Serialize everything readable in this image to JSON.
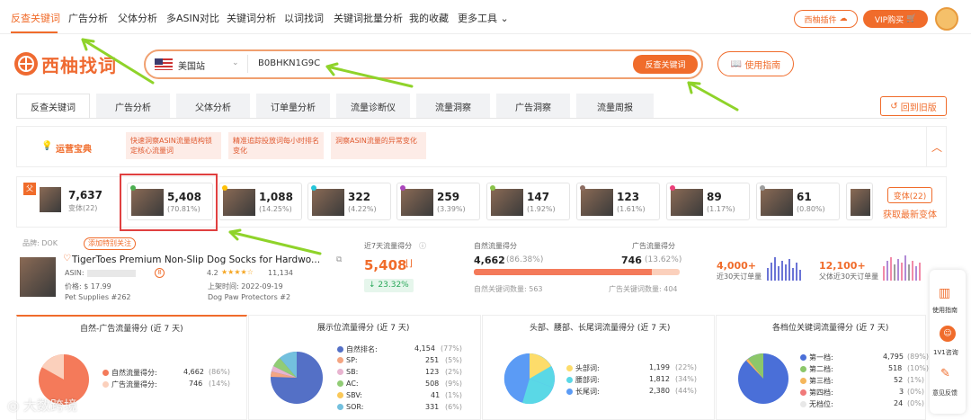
{
  "topnav": {
    "items": [
      "反查关键词",
      "广告分析",
      "父体分析",
      "多ASIN对比",
      "关键词分析",
      "以词找词",
      "关键词批量分析",
      "我的收藏",
      "更多工具"
    ],
    "plugin_button": "西柚插件",
    "vip_button": "VIP购买"
  },
  "brand": {
    "name": "西柚找词"
  },
  "search": {
    "marketplace": "美国站",
    "query": "B0BHKN1G9C",
    "submit_label": "反查关键词",
    "guide_label": "使用指南"
  },
  "tabs": [
    "反查关键词",
    "广告分析",
    "父体分析",
    "订单量分析",
    "流量诊断仪",
    "流量洞察",
    "广告洞察",
    "流量周报"
  ],
  "back_old_label": "回到旧版",
  "ops": {
    "label": "运营宝典",
    "tips": [
      "快速洞察ASIN流量结构锁定核心流量词",
      "精准追踪投放词每小时排名变化",
      "洞察ASIN流量的异常变化"
    ]
  },
  "variants": {
    "badge": "父",
    "parent": {
      "value": "7,637",
      "sub": "变体(22)"
    },
    "items": [
      {
        "value": "5,408",
        "pct": "(70.81%)",
        "dot": "#4caf50"
      },
      {
        "value": "1,088",
        "pct": "(14.25%)",
        "dot": "#ffc107"
      },
      {
        "value": "322",
        "pct": "(4.22%)",
        "dot": "#26c6da"
      },
      {
        "value": "259",
        "pct": "(3.39%)",
        "dot": "#ab47bc"
      },
      {
        "value": "147",
        "pct": "(1.92%)",
        "dot": "#8bc34a"
      },
      {
        "value": "123",
        "pct": "(1.61%)",
        "dot": "#8d6e63"
      },
      {
        "value": "89",
        "pct": "(1.17%)",
        "dot": "#ec407a"
      },
      {
        "value": "61",
        "pct": "(0.80%)",
        "dot": "#9e9e9e"
      }
    ],
    "count_button": "变体(22)",
    "fetch_label": "获取最新变体"
  },
  "product": {
    "brand": "品牌: DOK",
    "follow_button": "添加特别关注",
    "title": "TigerToes Premium Non-Slip Dog Socks for Hardwo...",
    "asin_label": "ASIN:",
    "price": "价格: $ 17.99",
    "rating": "4.2",
    "reviews": "11,134",
    "listed": "上架时间: 2022-09-19",
    "category1": "Pet Supplies #262",
    "category2": "Dog Paw Protectors #2"
  },
  "traffic": {
    "label": "近7天流量得分",
    "score": "5,408",
    "change": "↓ 23.32%",
    "natural_label": "自然流量得分",
    "natural_value": "4,662",
    "natural_pct": "(86.38%)",
    "ad_label": "广告流量得分",
    "ad_value": "746",
    "ad_pct": "(13.62%)",
    "natural_count": "自然关键词数量: 563",
    "ad_count": "广告关键词数量: 404",
    "natural_share": 0.8638
  },
  "orders": {
    "value1": "4,000+",
    "label1": "近30天订单量",
    "value2": "12,100+",
    "label2": "父体近30天订单量"
  },
  "panels": {
    "p1": {
      "title": "自然-广告流量得分 (近 7 天)",
      "rows": [
        {
          "label": "自然流量得分:",
          "value": "4,662",
          "pct": "(86%)",
          "color": "#f47a5a"
        },
        {
          "label": "广告流量得分:",
          "value": "746",
          "pct": "(14%)",
          "color": "#fbd0bc"
        }
      ]
    },
    "p2": {
      "title": "展示位流量得分 (近 7 天)",
      "rows": [
        {
          "label": "自然排名:",
          "value": "4,154",
          "pct": "(77%)",
          "color": "#5470c6"
        },
        {
          "label": "SP:",
          "value": "251",
          "pct": "(5%)",
          "color": "#f4a582"
        },
        {
          "label": "SB:",
          "value": "123",
          "pct": "(2%)",
          "color": "#e8b4d0"
        },
        {
          "label": "AC:",
          "value": "508",
          "pct": "(9%)",
          "color": "#91cc75"
        },
        {
          "label": "SBV:",
          "value": "41",
          "pct": "(1%)",
          "color": "#fac858"
        },
        {
          "label": "SOR:",
          "value": "331",
          "pct": "(6%)",
          "color": "#73c0de"
        }
      ]
    },
    "p3": {
      "title": "头部、腰部、长尾词流量得分 (近 7 天)",
      "rows": [
        {
          "label": "头部词:",
          "value": "1,199",
          "pct": "(22%)",
          "color": "#fddc6a"
        },
        {
          "label": "腰部词:",
          "value": "1,812",
          "pct": "(34%)",
          "color": "#5ad8e6"
        },
        {
          "label": "长尾词:",
          "value": "2,380",
          "pct": "(44%)",
          "color": "#5b9bf5"
        }
      ]
    },
    "p4": {
      "title": "各档位关键词流量得分 (近 7 天)",
      "rows": [
        {
          "label": "第一档:",
          "value": "4,795",
          "pct": "(89%)",
          "color": "#4a6fd8"
        },
        {
          "label": "第二档:",
          "value": "518",
          "pct": "(10%)",
          "color": "#8cc76a"
        },
        {
          "label": "第三档:",
          "value": "52",
          "pct": "(1%)",
          "color": "#f5b75c"
        },
        {
          "label": "第四档:",
          "value": "3",
          "pct": "(0%)",
          "color": "#f07a7a"
        },
        {
          "label": "无档位:",
          "value": "24",
          "pct": "(0%)",
          "color": "#e8e8e8"
        }
      ]
    }
  },
  "sidebar": [
    "使用指南",
    "1V1咨询",
    "意见反馈"
  ],
  "watermark": "大数跨境"
}
